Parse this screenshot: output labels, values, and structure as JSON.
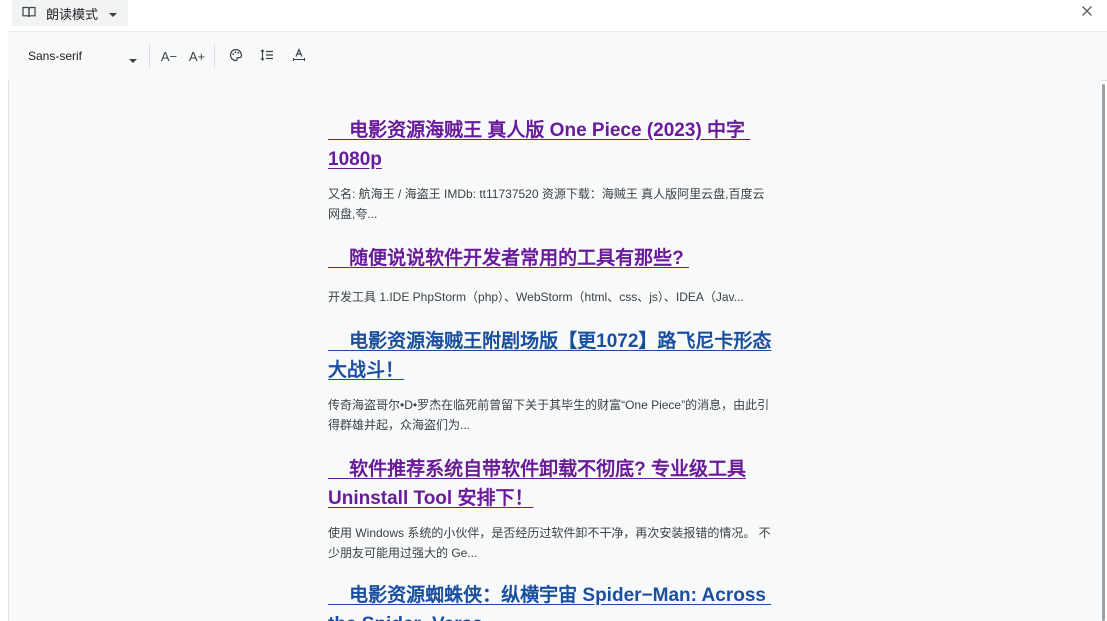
{
  "topbar": {
    "mode_label": "朗读模式",
    "close_label": "×"
  },
  "toolbar": {
    "font": "Sans-serif",
    "decrease_label": "A−",
    "increase_label": "A+"
  },
  "articles": [
    {
      "title": "    电影资源海贼王 真人版 One Piece (2023) 中字 1080p",
      "desc": "又名: 航海王 / 海盗王 IMDb: tt11737520 资源下载：海贼王 真人版阿里云盘,百度云网盘,夸...",
      "state": "visited"
    },
    {
      "title": "    随便说说软件开发者常用的工具有那些? ",
      "desc": "开发工具 1.IDE PhpStorm（php）、WebStorm（html、css、js）、IDEA（Jav...",
      "state": "visited"
    },
    {
      "title": "    电影资源海贼王附剧场版【更1072】路飞尼卡形态大战斗！",
      "desc": "传奇海盗哥尔•D•罗杰在临死前曾留下关于其毕生的财富“One Piece”的消息，由此引得群雄并起，众海盗们为...",
      "state": "link"
    },
    {
      "title": "    软件推荐系统自带软件卸载不彻底? 专业级工具Uninstall Tool 安排下！",
      "desc": "使用 Windows 系统的小伙伴，是否经历过软件卸不干净，再次安装报错的情况。 不少朋友可能用过强大的 Ge...",
      "state": "visited"
    },
    {
      "title": "    电影资源蜘蛛侠：纵横宇宙 Spider−Man: Across the Spider−Verse",
      "desc": "",
      "state": "link"
    }
  ]
}
